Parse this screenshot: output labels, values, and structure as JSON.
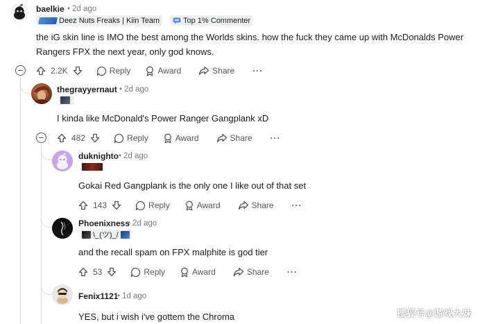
{
  "comments": [
    {
      "username": "baelkie",
      "time": "2d ago",
      "flairs": [
        {
          "text": "Deez Nuts Freaks | Kiin Team"
        },
        {
          "text": "Top 1% Commenter"
        }
      ],
      "body_line1": "the iG skin line is IMO the best among the Worlds skins. how the fuck they came up with McDonalds Power",
      "body_line2": "Rangers FPX the next year, only god knows.",
      "score": "2.2K",
      "reply_label": "Reply",
      "award_label": "Award",
      "share_label": "Share",
      "more_label": "···"
    },
    {
      "username": "thegrayyernaut",
      "time": "2d ago",
      "body": "I kinda like McDonald's Power Ranger Gangplank xD",
      "score": "482",
      "reply_label": "Reply",
      "award_label": "Award",
      "share_label": "Share",
      "more_label": "···"
    },
    {
      "username": "duknighto",
      "time": "2d ago",
      "body": "Gokai Red Gangplank is the only one I like out of that set",
      "score": "143",
      "reply_label": "Reply",
      "award_label": "Award",
      "share_label": "Share",
      "more_label": "···"
    },
    {
      "username": "Phoenixness",
      "time": "2d ago",
      "flair_text": "\\_(ツ)_/",
      "body": "and the recall spam on FPX malphite is god tier",
      "score": "53",
      "reply_label": "Reply",
      "award_label": "Award",
      "share_label": "Share",
      "more_label": "···"
    },
    {
      "username": "Fenix1121",
      "time": "1d ago",
      "body": "YES, but i wish i've gottem the Chroma"
    }
  ],
  "watermark": "搜狐号@游戏大妹",
  "icons": {
    "upvote": "arrow-up-icon",
    "downvote": "arrow-down-icon",
    "reply": "speech-bubble-icon",
    "award": "award-ribbon-icon",
    "share": "share-arrow-icon",
    "collapse": "collapse-minus-icon"
  },
  "colors": {
    "text": "#1c1c1c",
    "muted": "#7c7c7c",
    "action": "#555555",
    "thread": "#dcdcdc",
    "flair_bg": "#edeff1"
  }
}
